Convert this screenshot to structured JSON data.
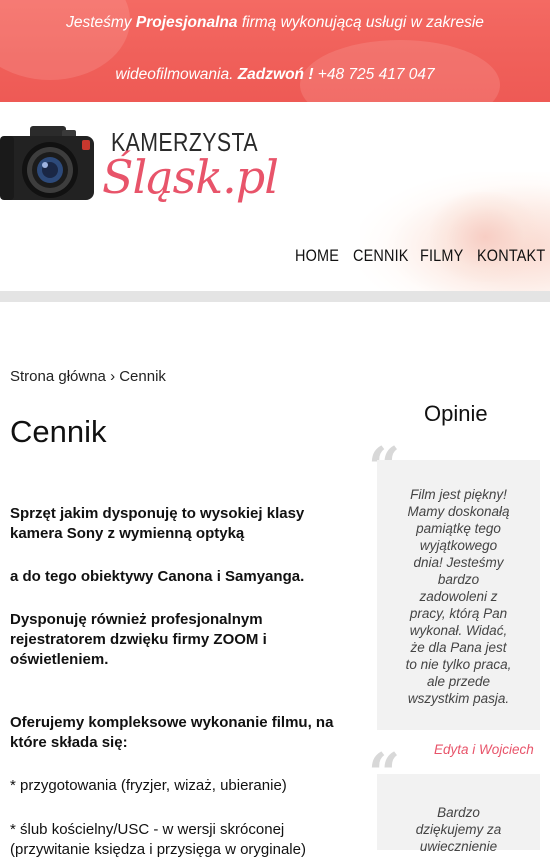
{
  "topbar": {
    "line1_pre": "Jesteśmy ",
    "line1_bold": "Projesjonalna",
    "line1_post": " firmą wykonującą usługi w zakresie",
    "line2_pre": "wideofilmowania. ",
    "line2_bold": "Zadzwoń !",
    "line2_post": " +48 725 417 047"
  },
  "logo": {
    "top": "KAMERZYSTA",
    "script": "Śląsk.pl",
    "icon": "camera-icon"
  },
  "nav": [
    "HOME",
    "CENNIK",
    "FILMY",
    "KONTAKT"
  ],
  "breadcrumb": "Strona główna › Cennik",
  "page_title": "Cennik",
  "content": {
    "p1": "Sprzęt jakim dysponuję to wysokiej klasy kamera Sony z wymienną optyką",
    "p2": "a do tego obiektywy Canona i Samyanga.",
    "p3": "Dysponuję również profesjonalnym rejestratorem dzwięku firmy ZOOM i oświetleniem.",
    "p4": "Oferujemy kompleksowe wykonanie filmu, na które składa się:",
    "p5": "* przygotowania (fryzjer, wizaż, ubieranie)",
    "p6": "* ślub kościelny/USC - w wersji skróconej",
    "p7": "(przywitanie księdza i przysięga w oryginale)"
  },
  "sidebar": {
    "title": "Opinie",
    "quote_mark": "“",
    "testimonial1": "Film jest piękny! Mamy doskonałą pamiątkę tego wyjątkowego dnia! Jesteśmy bardzo zadowoleni z pracy, którą Pan wykonał. Widać, że dla Pana jest to nie tylko praca, ale przede wszystkim pasja.",
    "author1": "Edyta i Wojciech",
    "testimonial2": "Bardzo dziękujemy za uwiecznienie"
  },
  "colors": {
    "topbar": "#f0605a",
    "accent": "#e8546a",
    "quote_bg": "#f2f2f2"
  }
}
